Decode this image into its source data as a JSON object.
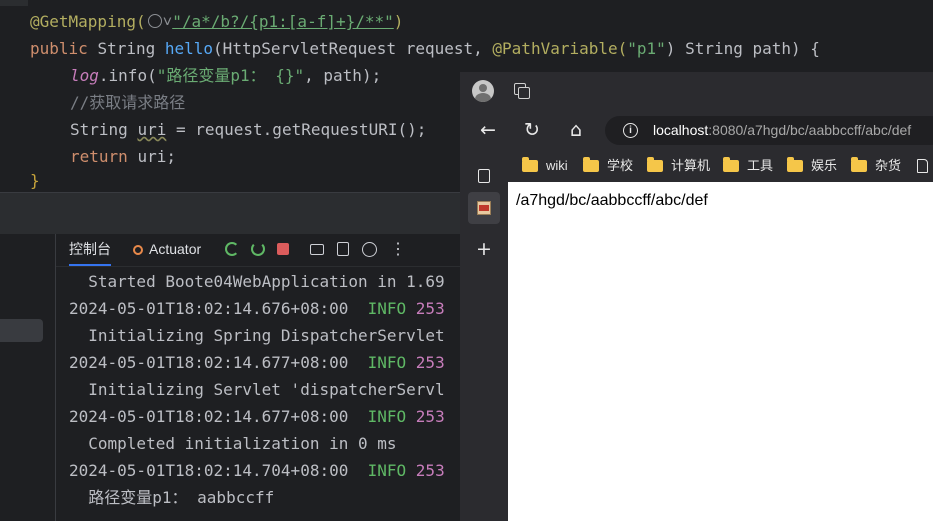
{
  "editor": {
    "lines": [
      {
        "annotation": "@GetMapping(",
        "path": "\"/a*/b?/{p1:[a-f]+}/**\"",
        "close": ")"
      },
      {
        "kw": "public ",
        "ret": "String ",
        "method": "hello",
        "params_a": "(HttpServletRequest request, ",
        "pv_ann": "@PathVariable(",
        "pv_val": "\"p1\"",
        "params_b": ") String path) {"
      },
      {
        "obj": "log",
        "call": ".info(",
        "str": "\"路径变量p1： {}\"",
        "rest": ", path);"
      },
      {
        "comment": "//获取请求路径"
      },
      {
        "type": "String ",
        "var": "uri",
        "rest": " = request.getRequestURI();"
      },
      {
        "kw": "return ",
        "rest": "uri;"
      },
      {
        "brace": "}"
      }
    ]
  },
  "run_window": {
    "tabs": {
      "console": "控制台",
      "actuator": "Actuator"
    },
    "icons": [
      "rerun-icon",
      "restart-icon",
      "stop-icon",
      "camera-icon",
      "exit-icon",
      "gauge-icon",
      "more-icon"
    ],
    "console_lines": [
      {
        "text": "  Started Boote04WebApplication in 1.69"
      },
      {
        "ts": "2024-05-01T18:02:14.676+08:00",
        "level": "INFO",
        "pid": "253"
      },
      {
        "text": "  Initializing Spring DispatcherServlet"
      },
      {
        "ts": "2024-05-01T18:02:14.677+08:00",
        "level": "INFO",
        "pid": "253"
      },
      {
        "text": "  Initializing Servlet 'dispatcherServl"
      },
      {
        "ts": "2024-05-01T18:02:14.677+08:00",
        "level": "INFO",
        "pid": "253"
      },
      {
        "text": "  Completed initialization in 0 ms"
      },
      {
        "ts": "2024-05-01T18:02:14.704+08:00",
        "level": "INFO",
        "pid": "253"
      },
      {
        "text": "  路径变量p1： aabbccff"
      }
    ]
  },
  "browser": {
    "address": {
      "host": "localhost",
      "rest": ":8080/a7hgd/bc/aabbccff/abc/def"
    },
    "bookmarks": [
      "wiki",
      "学校",
      "计算机",
      "工具",
      "娱乐",
      "杂货"
    ],
    "content": {
      "text": "/a7hgd/bc/aabbccff/abc/def"
    }
  },
  "colors": {
    "editor_bg": "#1e1f22",
    "keyword": "#cf8e6d",
    "string": "#6aab73",
    "info": "#5fb865",
    "accent": "#3574f0",
    "folder": "#f5c649"
  }
}
